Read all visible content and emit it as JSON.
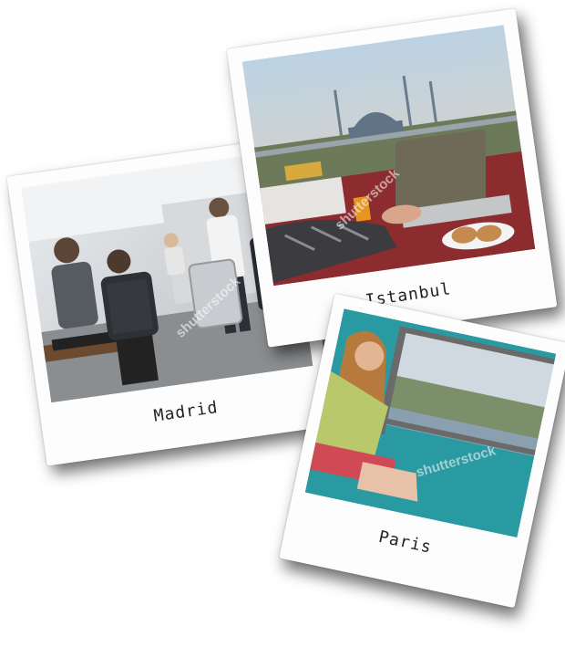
{
  "photos": [
    {
      "caption": "Madrid",
      "watermark": "shutterstock"
    },
    {
      "caption": "Istanbul",
      "watermark": "shutterstock"
    },
    {
      "caption": "Paris",
      "watermark": "shutterstock"
    }
  ],
  "colors": {
    "card": "#fdfdfd",
    "shadow": "#000000"
  }
}
